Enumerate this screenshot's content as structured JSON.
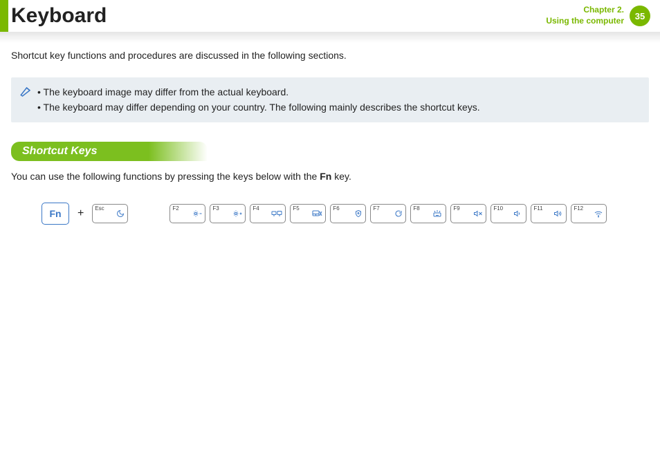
{
  "header": {
    "title": "Keyboard",
    "chapter_line1": "Chapter 2.",
    "chapter_line2": "Using the computer",
    "page_number": "35"
  },
  "intro": "Shortcut key functions and procedures are discussed in the following sections.",
  "notes": {
    "item1": "The keyboard image may differ from the actual keyboard.",
    "item2": "The keyboard may differ depending on your country. The following mainly describes the shortcut keys."
  },
  "section": {
    "heading": "Shortcut Keys",
    "desc_before": "You can use the following functions by pressing the keys below with the ",
    "desc_bold": "Fn",
    "desc_after": " key."
  },
  "keys": {
    "fn": "Fn",
    "plus": "+",
    "esc": "Esc",
    "f2": "F2",
    "f3": "F3",
    "f4": "F4",
    "f5": "F5",
    "f6": "F6",
    "f7": "F7",
    "f8": "F8",
    "f9": "F9",
    "f10": "F10",
    "f11": "F11",
    "f12": "F12"
  },
  "icons": {
    "esc": "moon",
    "f2": "brightness-down",
    "f3": "brightness-up",
    "f4": "display-switch",
    "f5": "touchpad",
    "f6": "shield",
    "f7": "refresh",
    "f8": "keyboard-light",
    "f9": "mute",
    "f10": "volume-down",
    "f11": "volume-up",
    "f12": "wifi"
  }
}
